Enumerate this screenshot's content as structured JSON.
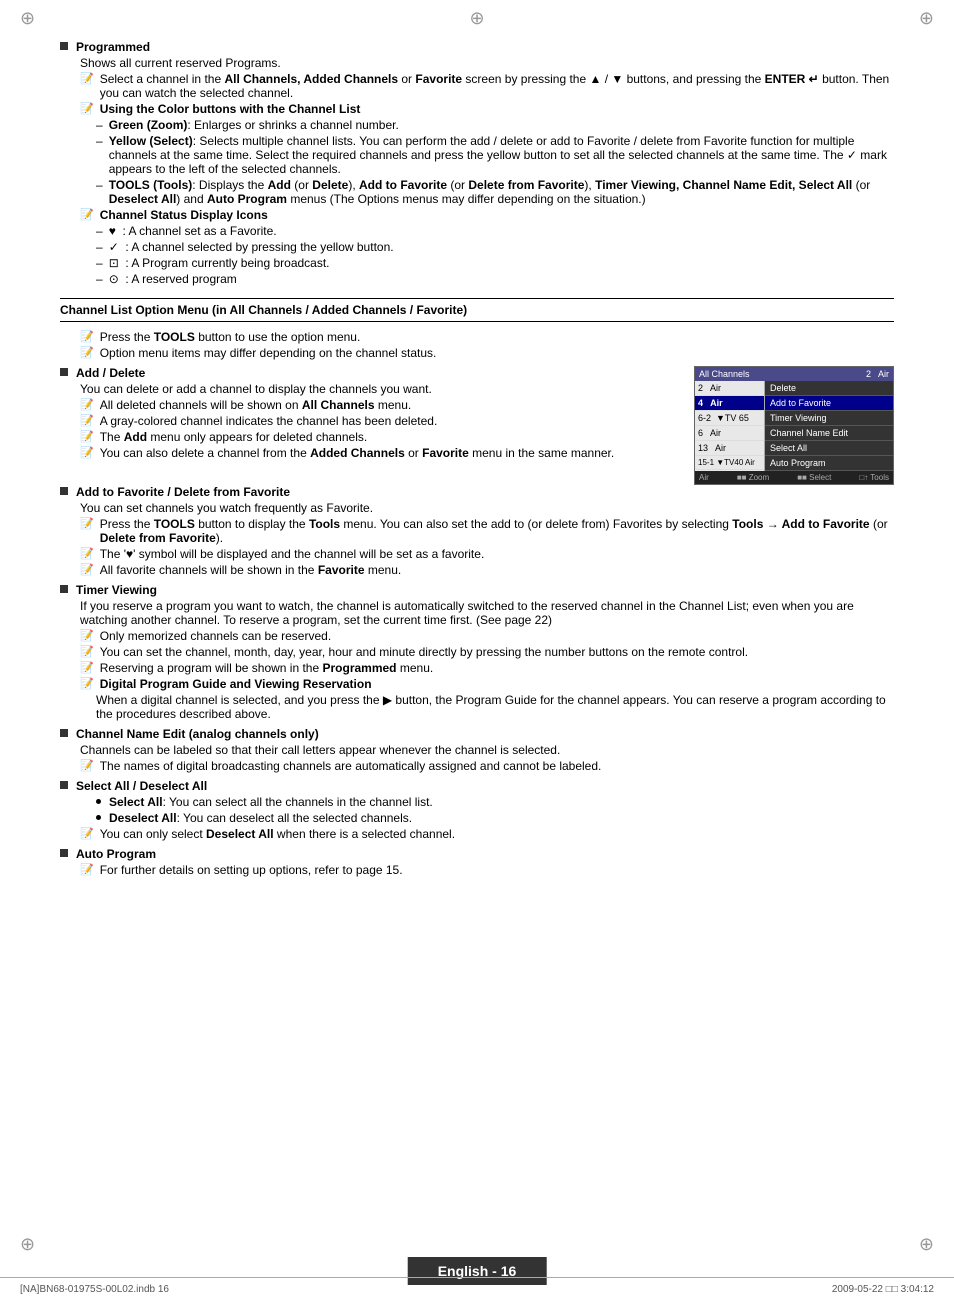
{
  "page": {
    "crosshairs": [
      "⊕",
      "⊕",
      "⊕",
      "⊕",
      "⊕"
    ],
    "footer_left": "[NA]BN68-01975S-00L02.indb   16",
    "footer_right": "2009-05-22   □□ 3:04:12",
    "page_number": "English - 16"
  },
  "sections": {
    "programmed": {
      "title": "Programmed",
      "desc": "Shows all current reserved Programs.",
      "note1": "Select a channel in the All Channels, Added Channels or Favorite screen by pressing the ▲ / ▼ buttons, and pressing the ENTER ↵ button. Then you can watch the selected channel.",
      "color_buttons_title": "Using the Color buttons with the Channel List",
      "green_label": "Green (Zoom)",
      "green_desc": ": Enlarges or shrinks a channel number.",
      "yellow_label": "Yellow (Select)",
      "yellow_desc": ": Selects multiple channel lists. You can perform the add / delete or add to Favorite / delete from Favorite function for multiple channels at the same time. Select the required channels and press the yellow button to set all the selected channels at the same time. The ✓ mark appears to the left of the selected channels.",
      "tools_label": "TOOLS (Tools)",
      "tools_desc": ": Displays the Add (or Delete), Add to Favorite (or Delete from Favorite), Timer Viewing, Channel Name Edit, Select All (or Deselect All) and Auto Program menus (The Options menus may differ depending on the situation.)",
      "channel_status_title": "Channel Status Display Icons",
      "icon1": "♥  : A channel set as a Favorite.",
      "icon2": "✓  : A channel selected by pressing the yellow button.",
      "icon3": "⊡  : A Program currently being broadcast.",
      "icon4": "⊙  : A reserved program"
    },
    "channel_list_option": {
      "title": "Channel List Option Menu (in All Channels / Added Channels / Favorite)",
      "note1": "Press the TOOLS button to use the option menu.",
      "note2": "Option menu items may differ depending on the channel status."
    },
    "add_delete": {
      "title": "Add / Delete",
      "desc": "You can delete or add a channel to display the channels you want.",
      "note1": "All deleted channels will be shown on All Channels menu.",
      "note2": "A gray-colored channel indicates the channel has been deleted.",
      "note3": "The Add menu only appears for deleted channels.",
      "note4": "You can also delete a channel from the Added Channels or Favorite menu in the same manner."
    },
    "add_to_favorite": {
      "title": "Add to Favorite / Delete from Favorite",
      "desc": "You can set channels you watch frequently as Favorite.",
      "note1": "Press the TOOLS button to display the Tools menu. You can also set the add to (or delete from) Favorites by selecting Tools → Add to Favorite (or Delete from Favorite).",
      "note2": "The '♥' symbol will be displayed and the channel will be set as a favorite.",
      "note3": "All favorite channels will be shown in the Favorite menu."
    },
    "timer_viewing": {
      "title": "Timer Viewing",
      "desc": "If you reserve a program you want to watch, the channel is automatically switched to the reserved channel in the Channel List; even when you are watching another channel. To reserve a program, set the current time first. (See page 22)",
      "note1": "Only memorized channels can be reserved.",
      "note2": "You can set the channel, month, day, year, hour and minute directly by pressing the number buttons on the remote control.",
      "note3": "Reserving a program will be shown in the Programmed menu.",
      "digital_title": "Digital Program Guide and Viewing Reservation",
      "digital_desc": "When a digital channel is selected, and you press the ▶ button, the Program Guide for the channel appears. You can reserve a program according to the procedures described above."
    },
    "channel_name_edit": {
      "title": "Channel Name Edit (analog channels only)",
      "desc": "Channels can be labeled so that their call letters appear whenever the channel is selected.",
      "note1": "The names of digital broadcasting channels are automatically assigned and cannot be labeled."
    },
    "select_all": {
      "title": "Select All / Deselect All",
      "select_label": "Select All",
      "select_desc": ": You can select all the channels in the channel list.",
      "deselect_label": "Deselect All",
      "deselect_desc": ": You can deselect all the selected channels.",
      "note1": "You can only select Deselect All when there is a selected channel."
    },
    "auto_program": {
      "title": "Auto Program",
      "note1": "For further details on setting up options, refer to page 15."
    }
  },
  "tv_ui": {
    "header": "All Channels",
    "channels": [
      {
        "num": "2",
        "type": "Air",
        "selected": false
      },
      {
        "num": "4",
        "type": "Air",
        "selected": true
      },
      {
        "num": "6-2",
        "type": "▼TV 65",
        "selected": false
      },
      {
        "num": "6",
        "type": "Air",
        "selected": false
      },
      {
        "num": "13",
        "type": "Air",
        "selected": false
      },
      {
        "num": "15-1",
        "type": "▼TV 40  Air",
        "selected": false
      }
    ],
    "menu_items": [
      {
        "label": "Delete",
        "active": false
      },
      {
        "label": "Add to Favorite",
        "active": true
      },
      {
        "label": "Timer Viewing",
        "active": false
      },
      {
        "label": "Channel Name Edit",
        "active": false
      },
      {
        "label": "Select All",
        "active": false
      },
      {
        "label": "Auto Program",
        "active": false
      }
    ],
    "footer": "Air    ■■ Zoom   ■■ Select   □↑ Tools"
  }
}
